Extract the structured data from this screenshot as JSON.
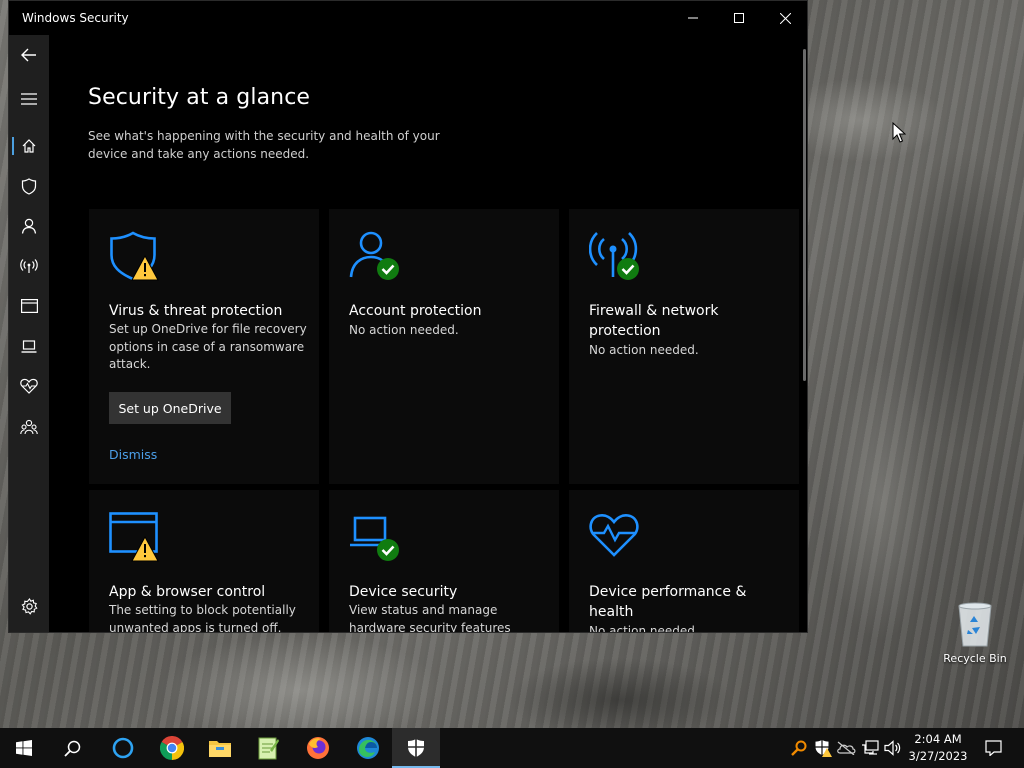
{
  "window": {
    "title": "Windows Security",
    "controls": {
      "minimize": "minimize-icon",
      "maximize": "maximize-icon",
      "close": "close-icon"
    }
  },
  "nav": {
    "items": [
      {
        "id": "back",
        "icon": "back-arrow-icon"
      },
      {
        "id": "menu",
        "icon": "hamburger-icon"
      },
      {
        "id": "home",
        "icon": "home-icon",
        "active": true
      },
      {
        "id": "virus",
        "icon": "shield-icon"
      },
      {
        "id": "account",
        "icon": "person-icon"
      },
      {
        "id": "firewall",
        "icon": "antenna-icon"
      },
      {
        "id": "app-browser",
        "icon": "browser-window-icon"
      },
      {
        "id": "device-security",
        "icon": "laptop-icon"
      },
      {
        "id": "device-performance",
        "icon": "heart-pulse-icon"
      },
      {
        "id": "family",
        "icon": "family-icon"
      },
      {
        "id": "settings",
        "icon": "gear-icon"
      }
    ]
  },
  "main": {
    "title": "Security at a glance",
    "subtitle": "See what's happening with the security and health of your device and take any actions needed.",
    "tiles": [
      {
        "name": "Virus & threat protection",
        "description": "Set up OneDrive for file recovery options in case of a ransomware attack.",
        "status": "warning",
        "icon": "shield-warning-icon",
        "action_button": "Set up OneDrive",
        "dismiss_link": "Dismiss"
      },
      {
        "name": "Account protection",
        "description": "No action needed.",
        "status": "ok",
        "icon": "person-check-icon"
      },
      {
        "name": "Firewall & network protection",
        "description": "No action needed.",
        "status": "ok",
        "icon": "antenna-check-icon"
      },
      {
        "name": "App & browser control",
        "description": "The setting to block potentially unwanted apps is turned off.",
        "status": "warning",
        "icon": "browser-warning-icon"
      },
      {
        "name": "Device security",
        "description": "View status and manage hardware security features",
        "status": "ok",
        "icon": "laptop-check-icon"
      },
      {
        "name": "Device performance & health",
        "description": "No action needed.",
        "status": "ok",
        "icon": "heart-pulse-icon"
      }
    ]
  },
  "desktop": {
    "recycle_bin_label": "Recycle Bin"
  },
  "taskbar": {
    "apps": [
      {
        "name": "start",
        "icon": "windows-logo-icon"
      },
      {
        "name": "search",
        "icon": "search-icon"
      },
      {
        "name": "cortana",
        "icon": "cortana-circle-icon"
      },
      {
        "name": "chrome",
        "icon": "chrome-icon"
      },
      {
        "name": "file-explorer",
        "icon": "folder-icon"
      },
      {
        "name": "notepad-plus",
        "icon": "notepad-icon"
      },
      {
        "name": "firefox",
        "icon": "firefox-icon"
      },
      {
        "name": "edge",
        "icon": "edge-icon"
      },
      {
        "name": "windows-security",
        "icon": "security-shield-icon",
        "active": true
      }
    ],
    "clock": {
      "time": "2:04 AM",
      "date": "3/27/2023"
    }
  },
  "colors": {
    "accent_blue": "#1e90ff",
    "warning_yellow": "#ffc83d",
    "ok_green": "#107c10",
    "link_blue": "#4c9fe8"
  }
}
